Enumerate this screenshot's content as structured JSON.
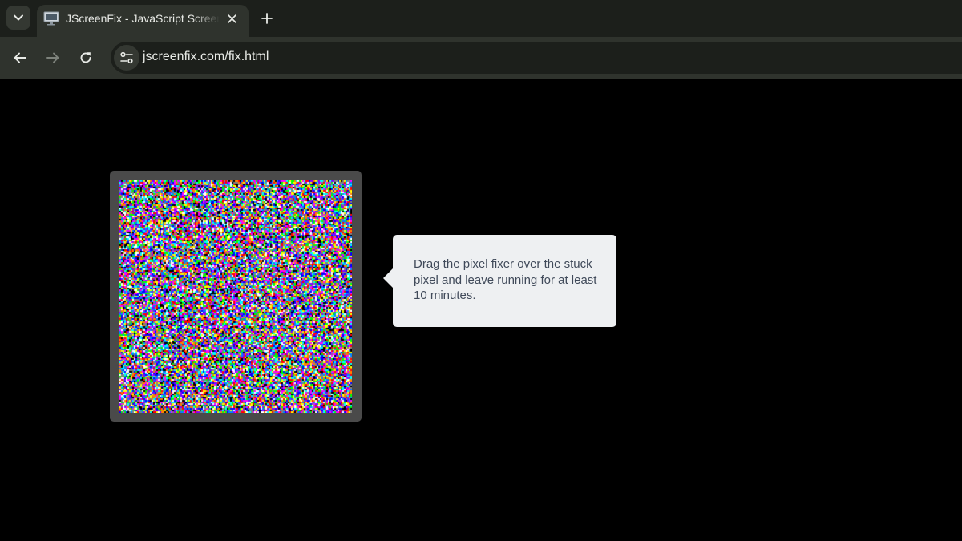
{
  "browser": {
    "tab": {
      "title": "JScreenFix - JavaScript Screen Pixel Fixer",
      "favicon": "monitor-icon"
    },
    "tab_search_icon": "chevron-down-icon",
    "new_tab_icon": "plus-icon",
    "close_tab_icon": "close-icon",
    "nav": {
      "back_icon": "arrow-left-icon",
      "forward_icon": "arrow-right-icon",
      "reload_icon": "reload-icon",
      "forward_enabled": false
    },
    "address_bar": {
      "url": "jscreenfix.com/fix.html",
      "site_info_icon": "tune-icon"
    },
    "colors": {
      "tabstrip": "#1c1f1b",
      "active_tab": "#2f332d",
      "omnibox": "#1c1f1b",
      "text": "#e8eae6"
    }
  },
  "page": {
    "background": "#000000",
    "pixel_fixer": {
      "frame_color": "#4a4a4a",
      "content": "random-color-noise"
    },
    "tooltip": {
      "text": "Drag the pixel fixer over the stuck pixel and leave running for at least 10 minutes.",
      "background": "#eef0f2",
      "text_color": "#404a5a"
    }
  }
}
